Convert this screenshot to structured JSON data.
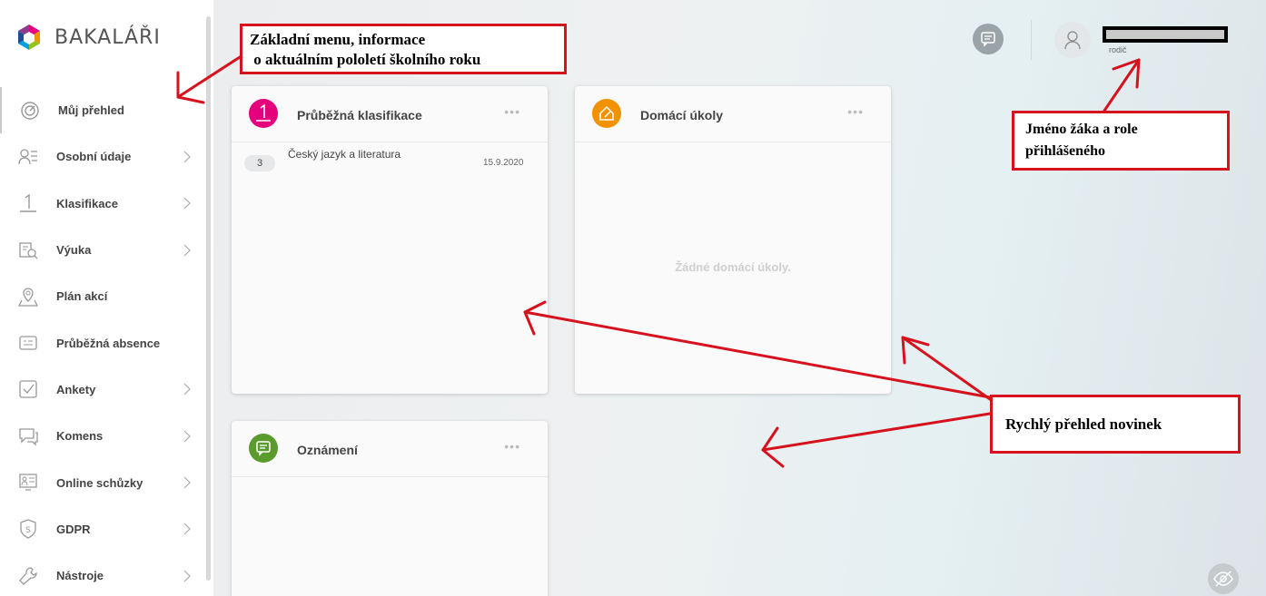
{
  "app": {
    "name": "BAKALÁŘI"
  },
  "sidebar": {
    "items": [
      {
        "label": "Můj přehled",
        "icon": "overview-gauge-icon",
        "has_submenu": false,
        "active": true
      },
      {
        "label": "Osobní údaje",
        "icon": "person-card-icon",
        "has_submenu": true
      },
      {
        "label": "Klasifikace",
        "icon": "grade-one-icon",
        "has_submenu": true
      },
      {
        "label": "Výuka",
        "icon": "book-search-icon",
        "has_submenu": true
      },
      {
        "label": "Plán akcí",
        "icon": "map-pin-icon",
        "has_submenu": false
      },
      {
        "label": "Průběžná absence",
        "icon": "absence-card-icon",
        "has_submenu": false
      },
      {
        "label": "Ankety",
        "icon": "checkbox-icon",
        "has_submenu": true
      },
      {
        "label": "Komens",
        "icon": "chat-bubble-icon",
        "has_submenu": true
      },
      {
        "label": "Online schůzky",
        "icon": "video-meeting-icon",
        "has_submenu": true
      },
      {
        "label": "GDPR",
        "icon": "shield-s-icon",
        "has_submenu": true
      },
      {
        "label": "Nástroje",
        "icon": "wrench-icon",
        "has_submenu": true
      }
    ]
  },
  "header": {
    "user_role": "rodič",
    "icons": [
      "message-icon",
      "user-icon"
    ]
  },
  "cards": {
    "grades": {
      "title": "Průběžná klasifikace",
      "icon_color": "#e4007c",
      "menu": "•••",
      "rows": [
        {
          "grade": "3",
          "subject": "Český jazyk a literatura",
          "date": "15.9.2020"
        }
      ]
    },
    "homework": {
      "title": "Domácí úkoly",
      "icon_color": "#f39200",
      "menu": "•••",
      "empty_text": "Žádné domácí úkoly."
    },
    "notices": {
      "title": "Oznámení",
      "icon_color": "#5a9b2e",
      "menu": "•••"
    }
  },
  "annotations": {
    "menu": "Základní menu, informace\n o aktuálním pololetí školního roku",
    "user": "Jméno žáka a role\npřihlášeného",
    "news": "Rychlý přehled novinek"
  },
  "colors": {
    "annotation_red": "#d5121d",
    "grades_pink": "#e4007c",
    "homework_orange": "#f39200",
    "notices_green": "#5a9b2e"
  }
}
